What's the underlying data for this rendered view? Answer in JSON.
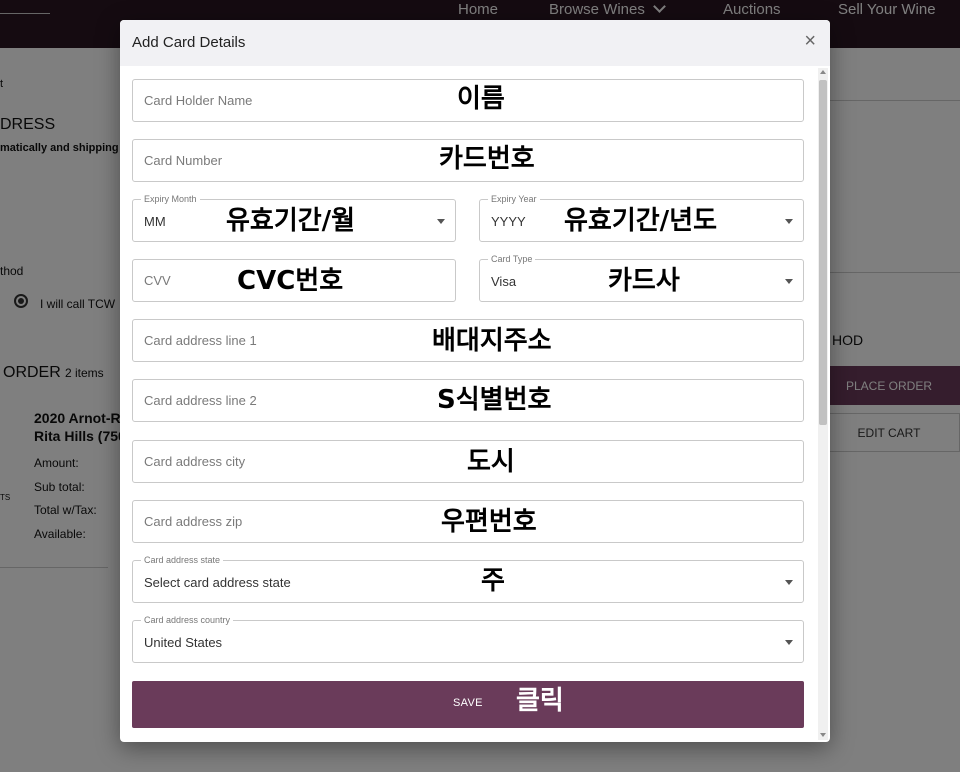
{
  "nav": {
    "items": [
      "Home",
      "Browse Wines",
      "Auctions",
      "Sell Your Wine"
    ]
  },
  "background": {
    "crumb": "t",
    "address_heading": "DRESS",
    "auto_text": "matically and shipping c",
    "method_label": "thod",
    "radio_label": "I will call TCW",
    "order_heading": "ORDER",
    "order_count": "2 items",
    "product_name_1": "2020 Arnot-R",
    "product_name_2": "Rita Hills (750",
    "amount_label": "Amount:",
    "subtotal_label": "Sub total:",
    "total_label": "Total w/Tax:",
    "available_label": "Available:",
    "left_glyph": "TS",
    "right_method": "HOD",
    "place_order": "PLACE ORDER",
    "edit_cart": "EDIT CART"
  },
  "modal": {
    "title": "Add Card Details",
    "close_glyph": "×",
    "fields": {
      "holder": {
        "placeholder": "Card Holder Name",
        "annotation": "이름"
      },
      "number": {
        "placeholder": "Card Number",
        "annotation": "카드번호"
      },
      "expiry_month": {
        "label": "Expiry Month",
        "value": "MM",
        "annotation": "유효기간/월"
      },
      "expiry_year": {
        "label": "Expiry Year",
        "value": "YYYY",
        "annotation": "유효기간/년도"
      },
      "cvv": {
        "placeholder": "CVV",
        "annotation": "CVC번호"
      },
      "card_type": {
        "label": "Card Type",
        "value": "Visa",
        "annotation": "카드사"
      },
      "line1": {
        "placeholder": "Card address line 1",
        "annotation": "배대지주소"
      },
      "line2": {
        "placeholder": "Card address line 2",
        "annotation": "S식별번호"
      },
      "city": {
        "placeholder": "Card address city",
        "annotation": "도시"
      },
      "zip": {
        "placeholder": "Card address zip",
        "annotation": "우편번호"
      },
      "state": {
        "label": "Card address state",
        "value": "Select card address state",
        "annotation": "주"
      },
      "country": {
        "label": "Card address country",
        "value": "United States"
      }
    },
    "save": {
      "label": "SAVE",
      "annotation": "클릭"
    }
  },
  "colors": {
    "nav_bg": "#2a1622",
    "accent": "#6a3b5a",
    "modal_header": "#f1f1f4"
  }
}
